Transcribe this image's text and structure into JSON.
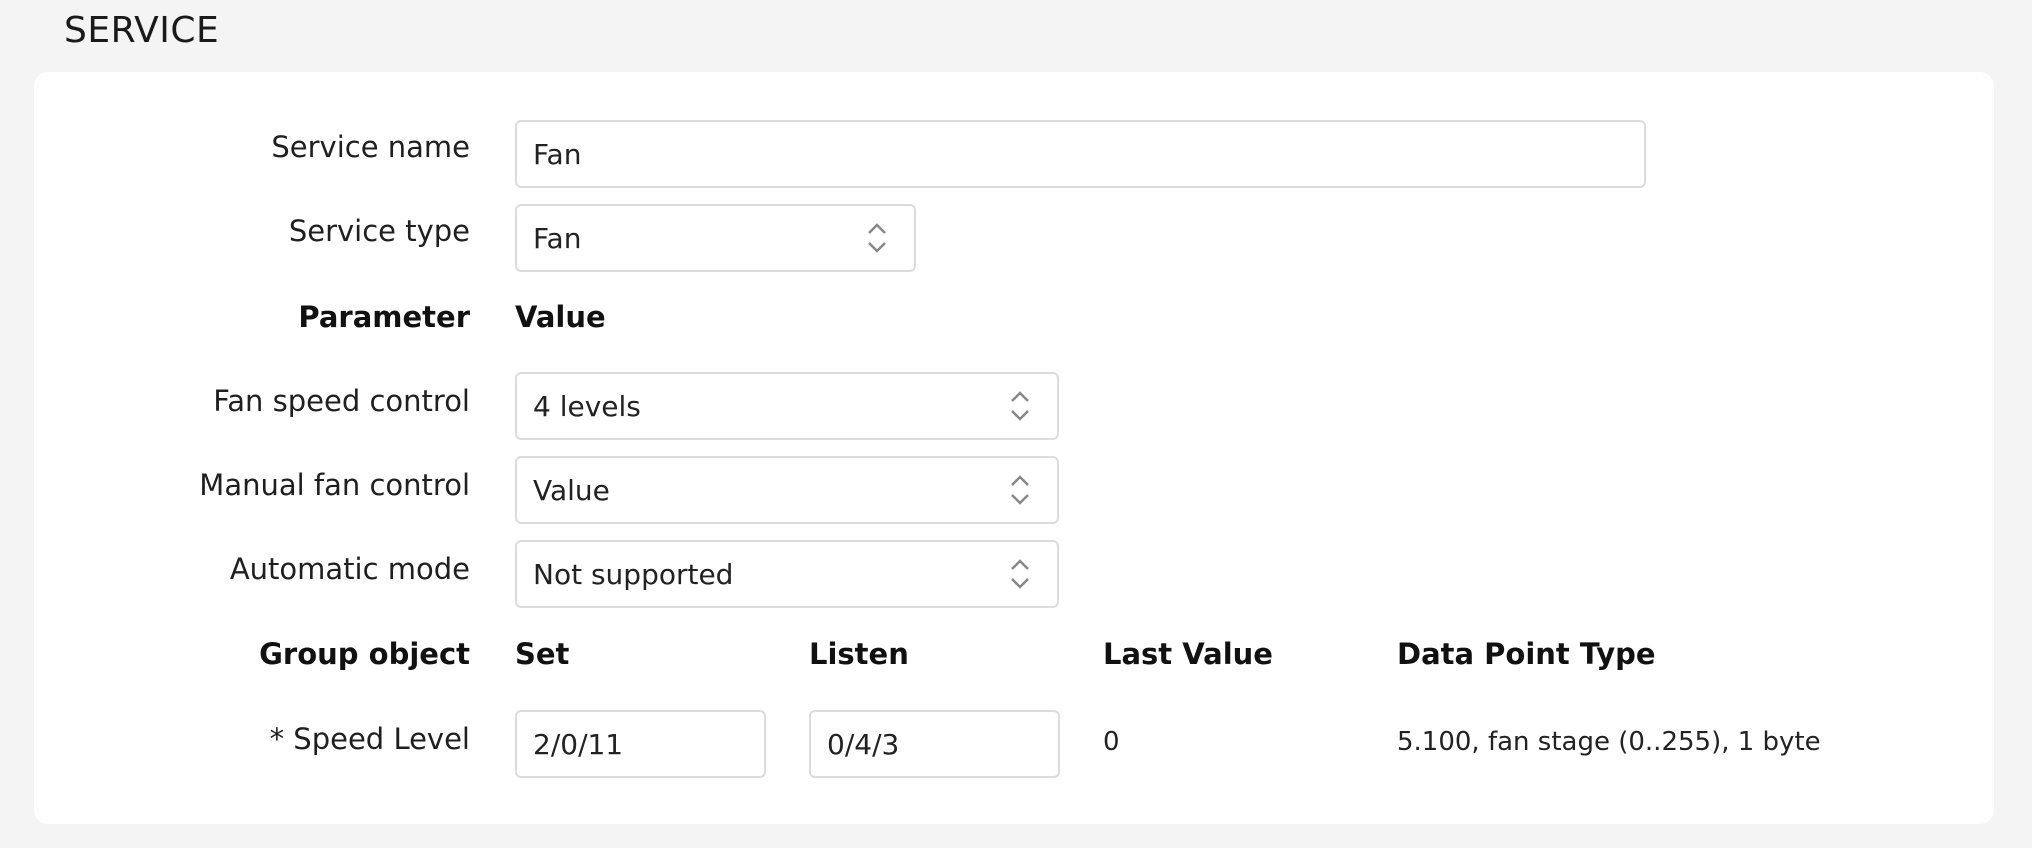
{
  "section": {
    "title": "SERVICE"
  },
  "service": {
    "name_label": "Service name",
    "name_value": "Fan",
    "type_label": "Service type",
    "type_value": "Fan"
  },
  "params": {
    "header_parameter": "Parameter",
    "header_value": "Value",
    "rows": [
      {
        "label": "Fan speed control",
        "value": "4 levels"
      },
      {
        "label": "Manual fan control",
        "value": "Value"
      },
      {
        "label": "Automatic mode",
        "value": "Not supported"
      }
    ]
  },
  "group_objects": {
    "headers": {
      "group_object": "Group object",
      "set": "Set",
      "listen": "Listen",
      "last_value": "Last Value",
      "dpt": "Data Point Type"
    },
    "rows": [
      {
        "name": "* Speed Level",
        "set": "2/0/11",
        "listen": "0/4/3",
        "last_value": "0",
        "dpt": "5.100, fan stage (0..255), 1 byte"
      }
    ]
  }
}
